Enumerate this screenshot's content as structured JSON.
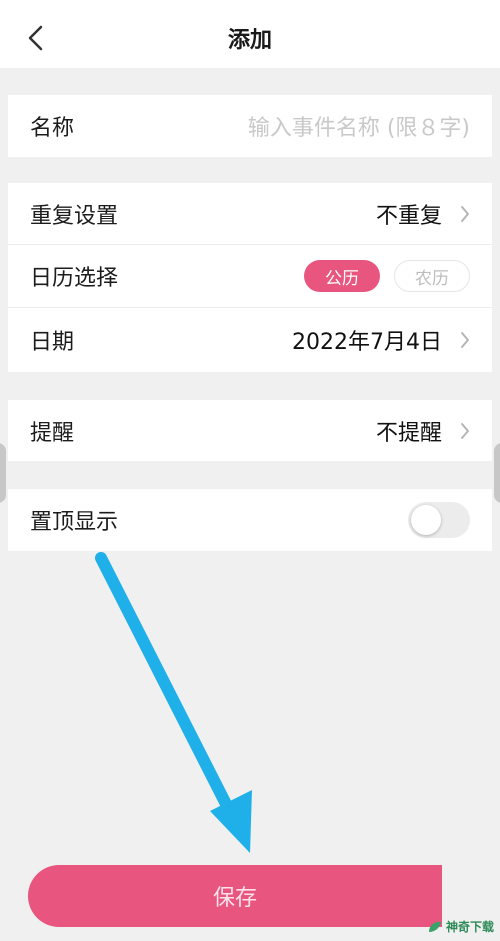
{
  "header": {
    "title": "添加"
  },
  "form": {
    "name": {
      "label": "名称",
      "placeholder": "输入事件名称 (限８字)"
    },
    "repeat": {
      "label": "重复设置",
      "value": "不重复"
    },
    "calendar": {
      "label": "日历选择",
      "options": [
        "公历",
        "农历"
      ],
      "selected": "公历"
    },
    "date": {
      "label": "日期",
      "value": "2022年7月4日"
    },
    "reminder": {
      "label": "提醒",
      "value": "不提醒"
    },
    "pin": {
      "label": "置顶显示",
      "enabled": false
    }
  },
  "save_label": "保存",
  "watermark": "神奇下载",
  "colors": {
    "accent": "#e8567f",
    "arrow": "#1fb0ea",
    "background": "#f0f0f0"
  }
}
